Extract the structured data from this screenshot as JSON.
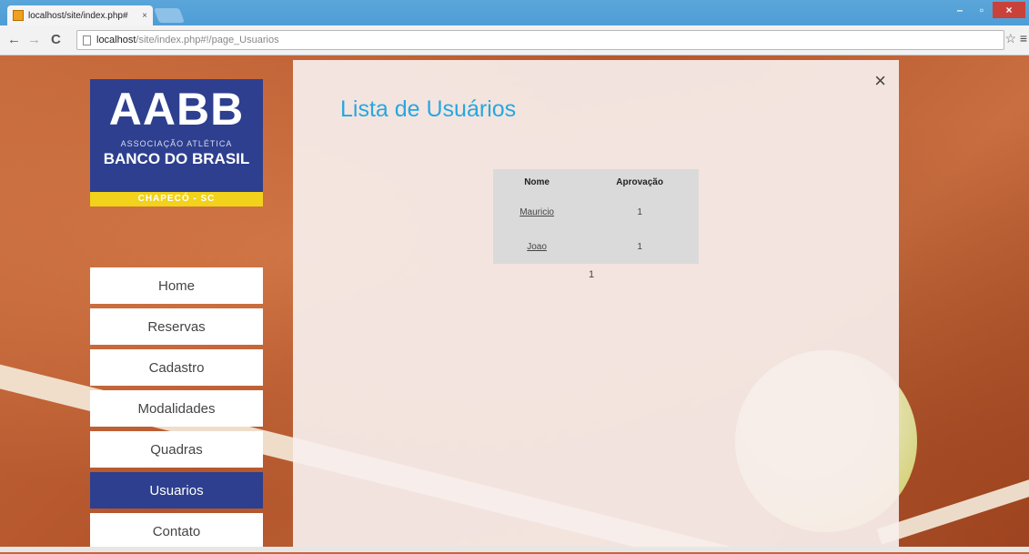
{
  "browser": {
    "tab_title": "localhost/site/index.php#",
    "tab_close": "×",
    "url_host": "localhost",
    "url_rest": "/site/index.php#!/page_Usuarios",
    "back": "←",
    "forward": "→",
    "reload": "C",
    "star": "☆",
    "menu": "≡",
    "minimize": "–",
    "maximize": "▫",
    "close": "×"
  },
  "logo": {
    "title": "AABB",
    "subtitle": "ASSOCIAÇÃO ATLÉTICA",
    "bank": "BANCO DO BRASIL",
    "city": "CHAPECÓ - SC",
    "brand_color": "#2d3f8e",
    "strip_color": "#f2d21a"
  },
  "nav": {
    "items": [
      {
        "label": "Home"
      },
      {
        "label": "Reservas"
      },
      {
        "label": "Cadastro"
      },
      {
        "label": "Modalidades"
      },
      {
        "label": "Quadras"
      },
      {
        "label": "Usuarios"
      },
      {
        "label": "Contato"
      }
    ],
    "active": "Usuarios"
  },
  "panel": {
    "close": "×",
    "title": "Lista de Usuários",
    "title_color": "#25a8e0"
  },
  "users_table": {
    "headers": [
      "Nome",
      "Aprovação"
    ],
    "rows": [
      {
        "name": "Mauricio",
        "approval": "1"
      },
      {
        "name": "Joao",
        "approval": "1"
      }
    ]
  },
  "pagination": {
    "page": "1"
  }
}
